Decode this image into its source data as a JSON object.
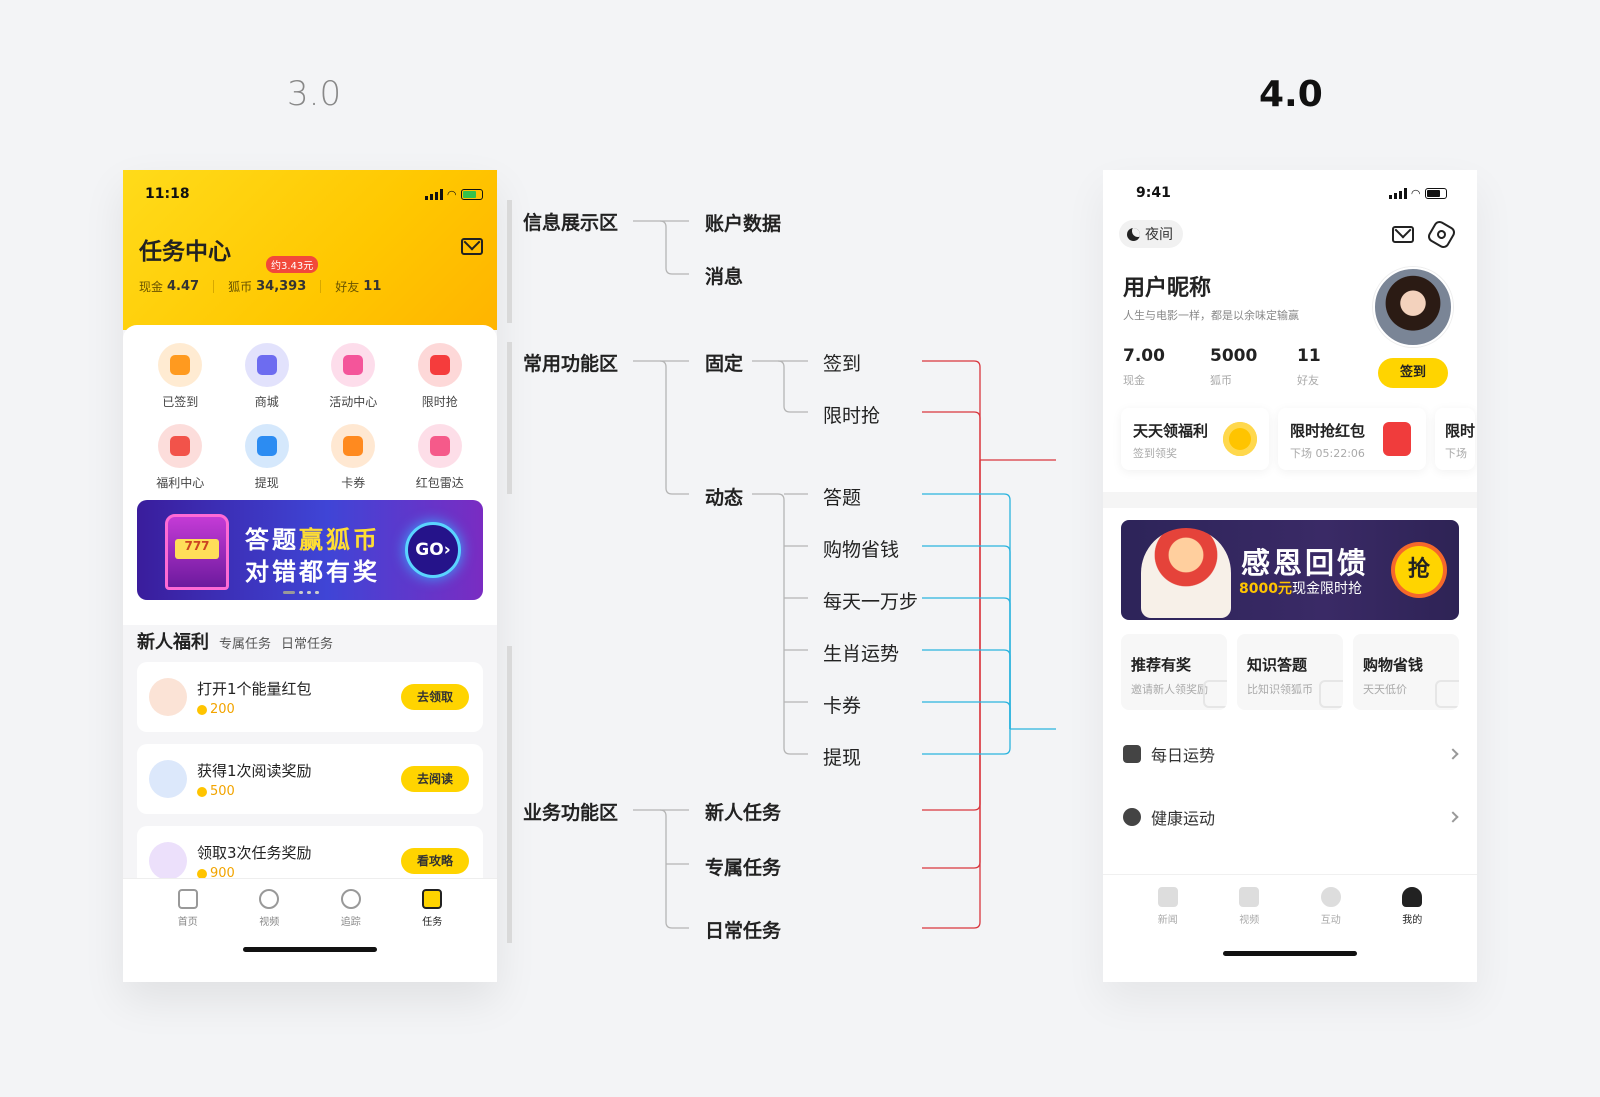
{
  "versions": {
    "old": "3.0",
    "new": "4.0"
  },
  "old_app": {
    "time": "11:18",
    "title": "任务中心",
    "stats": [
      {
        "label": "现金",
        "value": "4.47"
      },
      {
        "label": "狐币",
        "value": "34,393"
      },
      {
        "label": "好友",
        "value": "11"
      }
    ],
    "coin_tip": "约3.43元",
    "grid": [
      {
        "label": "已签到",
        "color": "#ff9a1f",
        "icon": "calendar-check-icon"
      },
      {
        "label": "商城",
        "color": "#6d6cf0",
        "icon": "shopping-bag-icon"
      },
      {
        "label": "活动中心",
        "color": "#f4559a",
        "icon": "gift-icon"
      },
      {
        "label": "限时抢",
        "color": "#f53c3c",
        "icon": "red-envelope-icon"
      },
      {
        "label": "福利中心",
        "color": "#f2534a",
        "icon": "medal-icon"
      },
      {
        "label": "提现",
        "color": "#2c8cf2",
        "icon": "wallet-icon"
      },
      {
        "label": "卡券",
        "color": "#ff8a1f",
        "icon": "ticket-icon"
      },
      {
        "label": "红包雷达",
        "color": "#f55a8a",
        "icon": "radar-icon"
      }
    ],
    "banner": {
      "line1_a": "答题",
      "line1_b": "赢狐币",
      "line2": "对错都有奖",
      "go": "GO"
    },
    "section": {
      "title": "新人福利",
      "tabs": [
        "专属任务",
        "日常任务"
      ]
    },
    "tasks": [
      {
        "title": "打开1个能量红包",
        "coins": "200",
        "button": "去领取",
        "color": "#fbe3d6"
      },
      {
        "title": "获得1次阅读奖励",
        "coins": "500",
        "button": "去阅读",
        "color": "#dce8fb"
      },
      {
        "title": "领取3次任务奖励",
        "coins": "900",
        "button": "看攻略",
        "color": "#ece0fb"
      }
    ],
    "tabbar": [
      "首页",
      "视频",
      "追踪",
      "任务"
    ]
  },
  "diagram": {
    "col1": [
      "信息展示区",
      "常用功能区",
      "业务功能区"
    ],
    "info": [
      "账户数据",
      "消息"
    ],
    "common": [
      "固定",
      "动态"
    ],
    "fixed": [
      "签到",
      "限时抢"
    ],
    "dynamic": [
      "答题",
      "购物省钱",
      "每天一万步",
      "生肖运势",
      "卡券",
      "提现"
    ],
    "business": [
      "新人任务",
      "专属任务",
      "日常任务"
    ],
    "colors": {
      "gray": "#b5b5b5",
      "red": "#d9363e",
      "blue": "#2ab3de"
    }
  },
  "new_app": {
    "time": "9:41",
    "night": "夜间",
    "nickname": "用户昵称",
    "signature": "人生与电影一样，都是以余味定输赢",
    "stats": [
      {
        "value": "7.00",
        "label": "现金"
      },
      {
        "value": "5000",
        "label": "狐币"
      },
      {
        "value": "11",
        "label": "好友"
      }
    ],
    "sign_button": "签到",
    "welfare": [
      {
        "title": "天天领福利",
        "sub": "签到领奖",
        "color": "#ffc400"
      },
      {
        "title": "限时抢红包",
        "sub": "下场 05:22:06",
        "color": "#f03c3c"
      },
      {
        "title": "限时",
        "sub": "下场",
        "color": "#ffffff"
      }
    ],
    "promo": {
      "title": "感恩回馈",
      "amount": "8000元",
      "sub": "现金限时抢",
      "grab": "抢"
    },
    "mini": [
      {
        "title": "推荐有奖",
        "sub": "邀请新人领奖励"
      },
      {
        "title": "知识答题",
        "sub": "比知识领狐币"
      },
      {
        "title": "购物省钱",
        "sub": "天天低价"
      }
    ],
    "rows": [
      "每日运势",
      "健康运动"
    ],
    "tabbar": [
      "新闻",
      "视频",
      "互动",
      "我的"
    ]
  }
}
